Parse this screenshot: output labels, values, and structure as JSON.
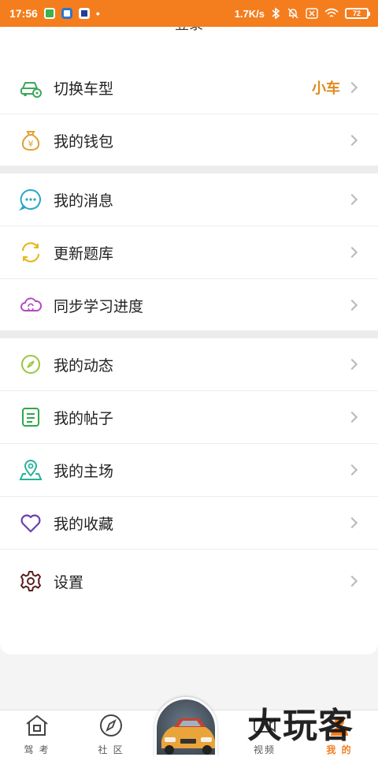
{
  "status_bar": {
    "time": "17:56",
    "dot": "•",
    "net_speed": "1.7K/s",
    "battery": "72"
  },
  "header": {
    "login_label": "登录"
  },
  "menu_groups": [
    [
      {
        "label": "切换车型",
        "value": "小车",
        "icon": "car-settings-icon"
      },
      {
        "label": "我的钱包",
        "icon": "money-bag-icon"
      }
    ],
    [
      {
        "label": "我的消息",
        "icon": "chat-bubble-icon"
      },
      {
        "label": "更新题库",
        "icon": "refresh-icon"
      },
      {
        "label": "同步学习进度",
        "icon": "cloud-sync-icon"
      }
    ],
    [
      {
        "label": "我的动态",
        "icon": "compass-icon"
      },
      {
        "label": "我的帖子",
        "icon": "document-icon"
      },
      {
        "label": "我的主场",
        "icon": "map-pin-icon"
      },
      {
        "label": "我的收藏",
        "icon": "heart-icon"
      },
      {
        "label": "设置",
        "icon": "gear-icon"
      }
    ]
  ],
  "bottom_nav": {
    "tabs": [
      {
        "label": "驾 考",
        "icon": "home-icon"
      },
      {
        "label": "社 区",
        "icon": "compass-icon"
      },
      {
        "label": "视频",
        "icon": "video-icon"
      },
      {
        "label": "我 的",
        "icon": "user-icon",
        "active": true
      }
    ]
  },
  "watermark": "大玩客",
  "colors": {
    "accent": "#f47d1e",
    "value_orange": "#e08a1e"
  }
}
